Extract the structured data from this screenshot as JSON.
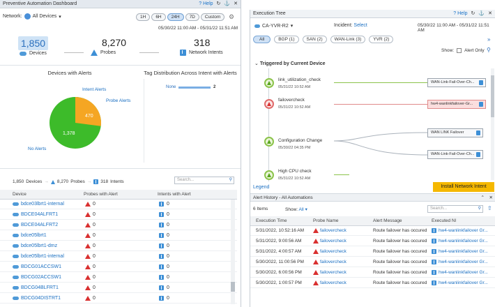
{
  "left": {
    "title": "Preventive Automation Dashboard",
    "help": "Help",
    "network_label": "Network:",
    "network_value": "All Devices",
    "time_buttons": [
      "1H",
      "6H",
      "24H",
      "7D",
      "Custom"
    ],
    "date_range": "05/30/22 11:00 AM - 05/31/22 11:51 AM",
    "stats": {
      "devices_value": "1,850",
      "devices_label": "Devices",
      "probes_value": "8,270",
      "probes_label": "Probes",
      "intents_value": "318",
      "intents_label": "Network Intents"
    },
    "pie": {
      "title": "Devices with Alerts",
      "intent_alerts_label": "Intent Alerts",
      "probe_alerts_label": "Probe Alerts",
      "no_alerts_label": "No Alerts",
      "probe_value": "470",
      "no_alert_value": "1,378"
    },
    "tag": {
      "title": "Tag Distribution Across Intent with Alerts",
      "none_label": "None",
      "none_value": "2"
    },
    "summary": {
      "devices_count": "1,850",
      "devices_label": "Devices",
      "probes_count": "8,270",
      "probes_label": "Probes",
      "intents_count": "318",
      "intents_label": "Intents",
      "search_placeholder": "Search..."
    },
    "table": {
      "headers": [
        "Device",
        "Probes with Alert",
        "Intents with Alert"
      ],
      "rows": [
        {
          "device": "bdce03lbrt1-internal",
          "probes": "0",
          "intents": "0"
        },
        {
          "device": "BDCE04ALFRT1",
          "probes": "0",
          "intents": "0"
        },
        {
          "device": "BDCE04ALFRT2",
          "probes": "0",
          "intents": "0"
        },
        {
          "device": "bdce05lbrt1",
          "probes": "0",
          "intents": "0"
        },
        {
          "device": "bdce05lbrt1-dmz",
          "probes": "0",
          "intents": "0"
        },
        {
          "device": "bdce05lbrt1-internal",
          "probes": "0",
          "intents": "0"
        },
        {
          "device": "BDCG01ACCSW1",
          "probes": "0",
          "intents": "0"
        },
        {
          "device": "BDCG02ACCSW1",
          "probes": "0",
          "intents": "0"
        },
        {
          "device": "BDCG04BLFRT1",
          "probes": "0",
          "intents": "0"
        },
        {
          "device": "BDCG04DISTRT1",
          "probes": "0",
          "intents": "0"
        }
      ]
    }
  },
  "right": {
    "title": "Execution Tree",
    "help": "Help",
    "device": "CA-YVR-R2",
    "incident_label": "Incident:",
    "incident_value": "Select",
    "date_range": "05/30/22 11:00 AM - 05/31/22 11:51 AM",
    "tabs": [
      "All",
      "BGP (1)",
      "SAN (2)",
      "WAN-Link (3)",
      "YVR (2)"
    ],
    "show_label": "Show:",
    "alert_only_label": "Alert Only",
    "tree_header": "Triggered by Current Device",
    "nodes": [
      {
        "name": "link_utilization_check",
        "time": "05/31/22 10:52 AM"
      },
      {
        "name": "failovercheck",
        "time": "05/31/22 10:52 AM"
      },
      {
        "name": "Configuration Change",
        "time": "05/30/22 04:35 PM"
      },
      {
        "name": "High CPU check",
        "time": "05/31/22 10:52 AM"
      }
    ],
    "ni_boxes": [
      "WAN-Link-Fail-Over-Ch...",
      "hw4-wanlinkfailover-Gr...",
      "WAN LINK Failover",
      "WAN-Link-Fail-Over-Ch..."
    ],
    "legend": "Legend",
    "install_btn": "Install Network Intent",
    "history_title": "Alert History - All Automations",
    "items_count": "6 Items",
    "show_all_label": "Show:",
    "show_all_value": "All",
    "search_placeholder": "Search...",
    "history_headers": [
      "Execution Time",
      "Probe Name",
      "Alert Message",
      "Executed NI"
    ],
    "history_rows": [
      {
        "time": "5/31/2022, 10:52:16 AM",
        "probe": "failovercheck",
        "msg": "Route failover has occured",
        "ni": "hw4-wanlinkfailover Gr..."
      },
      {
        "time": "5/31/2022, 9:00:56 AM",
        "probe": "failovercheck",
        "msg": "Route failover has occured",
        "ni": "hw4-wanlinkfailover Gr..."
      },
      {
        "time": "5/31/2022, 4:00:57 AM",
        "probe": "failovercheck",
        "msg": "Route failover has occured",
        "ni": "hw4-wanlinkfailover Gr..."
      },
      {
        "time": "5/30/2022, 11:00:56 PM",
        "probe": "failovercheck",
        "msg": "Route failover has occured",
        "ni": "hw4-wanlinkfailover Gr..."
      },
      {
        "time": "5/30/2022, 6:00:56 PM",
        "probe": "failovercheck",
        "msg": "Route failover has occured",
        "ni": "hw4-wanlinkfailover Gr..."
      },
      {
        "time": "5/30/2022, 1:00:57 PM",
        "probe": "failovercheck",
        "msg": "Route failover has occured",
        "ni": "hw4-wanlinkfailover Gr..."
      }
    ]
  }
}
